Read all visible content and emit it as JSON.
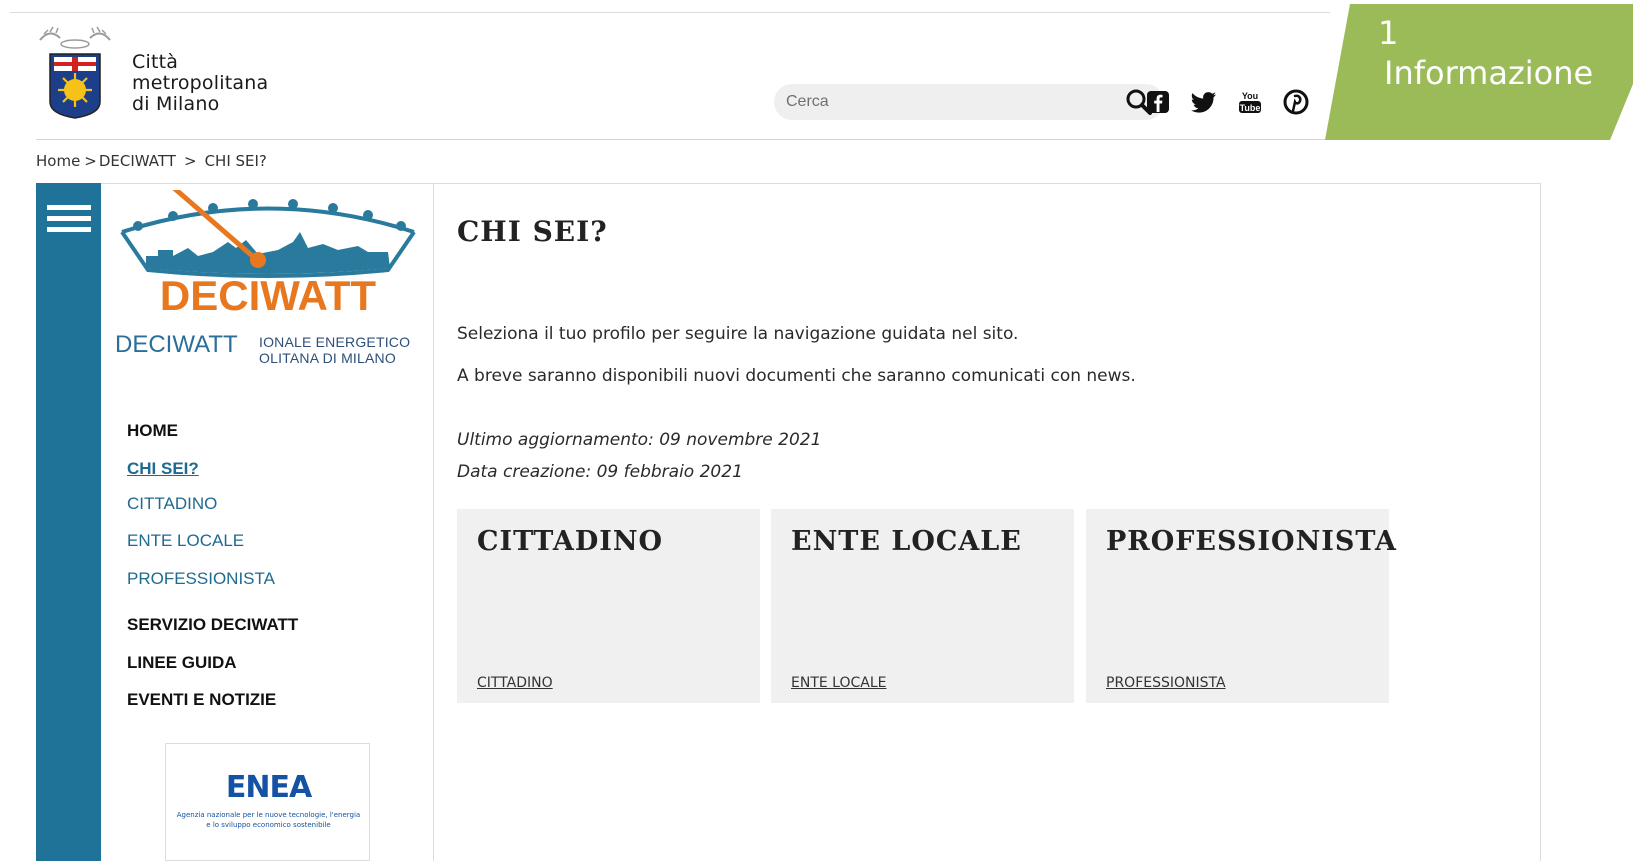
{
  "header": {
    "logo_lines": [
      "Città",
      "metropolitana",
      "di Milano"
    ],
    "search_placeholder": "Cerca",
    "social_icons": [
      "facebook-icon",
      "twitter-icon",
      "youtube-icon",
      "pinterest-icon"
    ],
    "youtube_text": [
      "You",
      "Tube"
    ]
  },
  "callout": {
    "number": "1",
    "label": "Informazione",
    "color": "#9bbb59"
  },
  "breadcrumb": [
    "Home",
    "DECIWATT",
    "CHI SEI?"
  ],
  "breadcrumb_sep": ">",
  "sidebar": {
    "accent_color": "#1f7399",
    "deciwatt_logo_text": "DECIWATT",
    "deciwatt_label": "DECIWATT",
    "deciwatt_sub": [
      "IONALE ENERGETICO",
      "OLITANA DI MILANO"
    ],
    "nav": [
      {
        "label": "HOME",
        "style": "main"
      },
      {
        "label": "CHI SEI?",
        "style": "active"
      },
      {
        "label": "CITTADINO",
        "style": "sub"
      },
      {
        "label": "ENTE LOCALE",
        "style": "sub"
      },
      {
        "label": "PROFESSIONISTA",
        "style": "sub"
      },
      {
        "label": "SERVIZIO DECIWATT",
        "style": "main"
      },
      {
        "label": "LINEE GUIDA",
        "style": "main"
      },
      {
        "label": "EVENTI E NOTIZIE",
        "style": "main"
      }
    ],
    "enea": {
      "title": "ENEA",
      "caption": "Agenzia nazionale per le nuove tecnologie, l'energia e lo sviluppo economico sostenibile"
    }
  },
  "content": {
    "title": "CHI SEI?",
    "paragraphs": [
      "Seleziona il tuo profilo per seguire la navigazione guidata nel sito.",
      "A breve saranno disponibili nuovi documenti che saranno comunicati con news."
    ],
    "updated": "Ultimo aggiornamento: 09 novembre 2021",
    "created": "Data creazione: 09 febbraio 2021",
    "cards": [
      {
        "title": "CITTADINO",
        "link": "CITTADINO"
      },
      {
        "title": "ENTE LOCALE",
        "link": "ENTE LOCALE"
      },
      {
        "title": "PROFESSIONISTA",
        "link": "PROFESSIONISTA"
      }
    ]
  }
}
